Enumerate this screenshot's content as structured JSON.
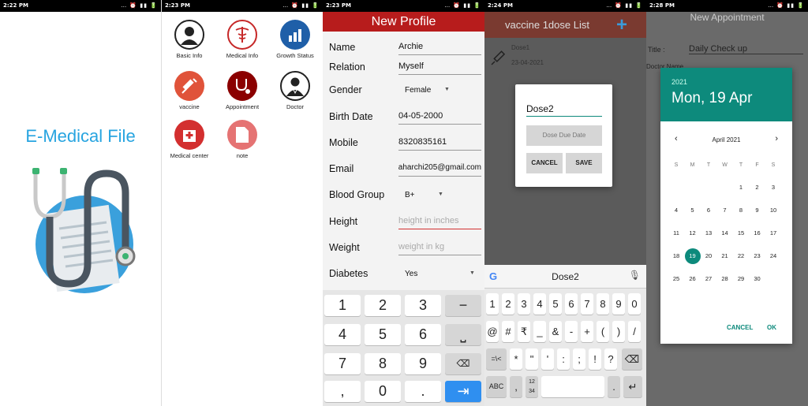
{
  "panels": {
    "p1": {
      "time": "2:22 PM",
      "title": "E-Medical File"
    },
    "p2": {
      "time": "2:23 PM",
      "menu": [
        {
          "label": "Basic Info",
          "icon": "person-icon",
          "color": "#ffffff"
        },
        {
          "label": "Medical Info",
          "icon": "caduceus-icon",
          "color": "#ffffff"
        },
        {
          "label": "Growth Status",
          "icon": "chart-icon",
          "color": "#1f5fa8"
        },
        {
          "label": "vaccine",
          "icon": "syringe-icon",
          "color": "#e0533a"
        },
        {
          "label": "Appointment",
          "icon": "stethoscope-icon",
          "color": "#8b0000"
        },
        {
          "label": "Doctor",
          "icon": "doctor-icon",
          "color": "#ffffff"
        },
        {
          "label": "Medical center",
          "icon": "hospital-icon",
          "color": "#d32f2f"
        },
        {
          "label": "note",
          "icon": "note-icon",
          "color": "#e57373"
        }
      ]
    },
    "p3": {
      "time": "2:23 PM",
      "header": "New Profile",
      "fields": {
        "name": {
          "label": "Name",
          "value": "Archie"
        },
        "relation": {
          "label": "Relation",
          "value": "Myself"
        },
        "gender": {
          "label": "Gender",
          "value": "Female"
        },
        "birth": {
          "label": "Birth Date",
          "value": "04-05-2000"
        },
        "mobile": {
          "label": "Mobile",
          "value": "8320835161"
        },
        "email": {
          "label": "Email",
          "value": "aharchi205@gmail.com"
        },
        "blood": {
          "label": "Blood Group",
          "value": "B+"
        },
        "height": {
          "label": "Height",
          "placeholder": "height in inches"
        },
        "weight": {
          "label": "Weight",
          "placeholder": "weight in kg"
        },
        "diabetes": {
          "label": "Diabetes",
          "value": "Yes"
        }
      },
      "keys": [
        "1",
        "2",
        "3",
        "−",
        "4",
        "5",
        "6",
        "⎵",
        "7",
        "8",
        "9",
        "⌫",
        ",",
        "0",
        ".",
        "⇥"
      ]
    },
    "p4": {
      "time": "2:24 PM",
      "header": "vaccine 1dose List",
      "list_item": {
        "name": "Dose1",
        "date": "23-04-2021"
      },
      "dialog": {
        "input": "Dose2",
        "due_button": "Dose Due Date",
        "cancel": "CANCEL",
        "save": "SAVE"
      },
      "suggestion": "Dose2",
      "row1": [
        "1",
        "2",
        "3",
        "4",
        "5",
        "6",
        "7",
        "8",
        "9",
        "0"
      ],
      "row2": [
        "@",
        "#",
        "₹",
        "_",
        "&",
        "-",
        "+",
        "(",
        ")",
        "/"
      ],
      "row3": [
        "=\\<",
        "*",
        "\"",
        "'",
        ":",
        ";",
        "!",
        "?",
        "⌫"
      ],
      "row4": [
        "ABC",
        ",",
        "12 34",
        "",
        ".",
        "↵"
      ]
    },
    "p5": {
      "time": "2:28 PM",
      "header": "New Appointment",
      "bg_title_label": "Title :",
      "bg_title_value": "Daily Check up",
      "bg_doctor": "Doctor Name",
      "calendar": {
        "year": "2021",
        "date": "Mon, 19 Apr",
        "month": "April 2021",
        "weekdays": [
          "S",
          "M",
          "T",
          "W",
          "T",
          "F",
          "S"
        ],
        "selected": "19",
        "cancel": "CANCEL",
        "ok": "OK"
      }
    }
  }
}
